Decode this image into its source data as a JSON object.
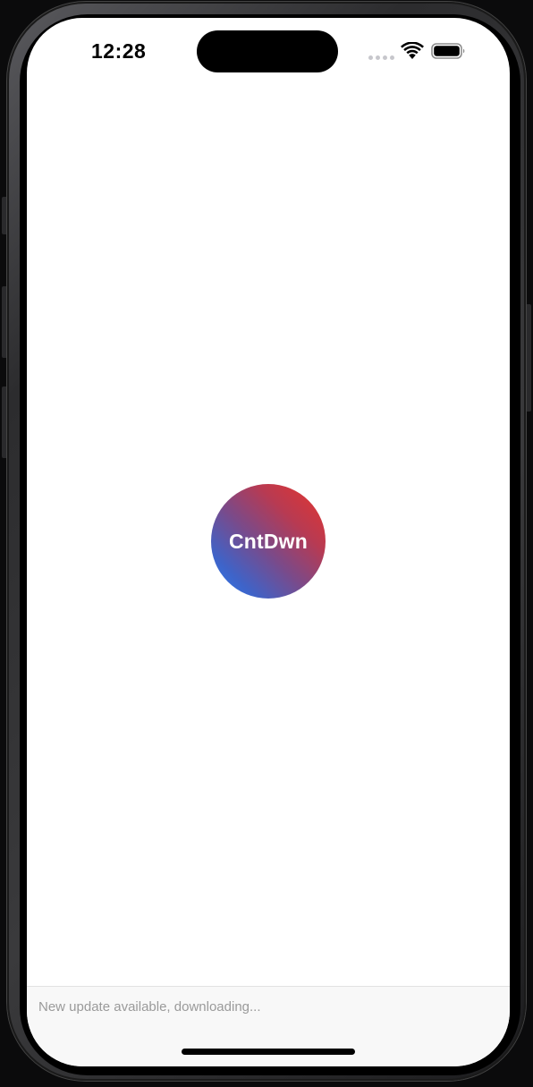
{
  "status_bar": {
    "time": "12:28",
    "icons": [
      "cellular-signal-icon",
      "wifi-icon",
      "battery-icon"
    ]
  },
  "app": {
    "logo_text": "CntDwn",
    "logo_colors": {
      "gradient_start": "#e8352b",
      "gradient_end": "#2b7df0"
    }
  },
  "update_banner": {
    "message": "New update available, downloading..."
  },
  "colors": {
    "screen_background": "#ffffff",
    "banner_background": "#f8f8f8",
    "banner_text": "#9a9a9a"
  }
}
